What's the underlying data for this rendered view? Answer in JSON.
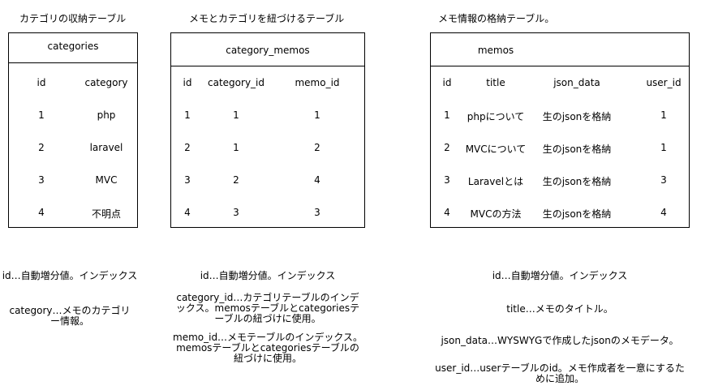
{
  "captions": {
    "categories": "カテゴリの収納テーブル",
    "category_memos": "メモとカテゴリを紐づけるテーブル",
    "memos": "メモ情報の格納テーブル。"
  },
  "tables": {
    "categories": {
      "name": "categories",
      "columns": [
        "id",
        "category"
      ],
      "rows": [
        [
          "1",
          "php"
        ],
        [
          "2",
          "laravel"
        ],
        [
          "3",
          "MVC"
        ],
        [
          "4",
          "不明点"
        ]
      ]
    },
    "category_memos": {
      "name": "category_memos",
      "columns": [
        "id",
        "category_id",
        "memo_id"
      ],
      "rows": [
        [
          "1",
          "1",
          "1"
        ],
        [
          "2",
          "1",
          "2"
        ],
        [
          "3",
          "2",
          "4"
        ],
        [
          "4",
          "3",
          "3"
        ]
      ]
    },
    "memos": {
      "name": "memos",
      "columns": [
        "id",
        "title",
        "json_data",
        "user_id"
      ],
      "rows": [
        [
          "1",
          "phpについて",
          "生のjsonを格納",
          "1"
        ],
        [
          "2",
          "MVCについて",
          "生のjsonを格納",
          "1"
        ],
        [
          "3",
          "Laravelとは",
          "生のjsonを格納",
          "3"
        ],
        [
          "4",
          "MVCの方法",
          "生のjsonを格納",
          "4"
        ]
      ]
    }
  },
  "notes": {
    "categories": {
      "id": "id…自動増分値。インデックス",
      "category": "category…メモのカテゴリー情報。"
    },
    "category_memos": {
      "id": "id…自動増分値。インデックス",
      "category_id": "category_id…カテゴリテーブルのインデックス。memosテーブルとcategoriesテーブルの紐づけに使用。",
      "memo_id": "memo_id…メモテーブルのインデックス。memosテーブルとcategoriesテーブルの紐づけに使用。"
    },
    "memos": {
      "id": "id…自動増分値。インデックス",
      "title": "title…メモのタイトル。",
      "json_data": "json_data…WYSWYGで作成したjsonのメモデータ。",
      "user_id": "user_id…userテーブルのid。メモ作成者を一意にするために追加。"
    }
  }
}
